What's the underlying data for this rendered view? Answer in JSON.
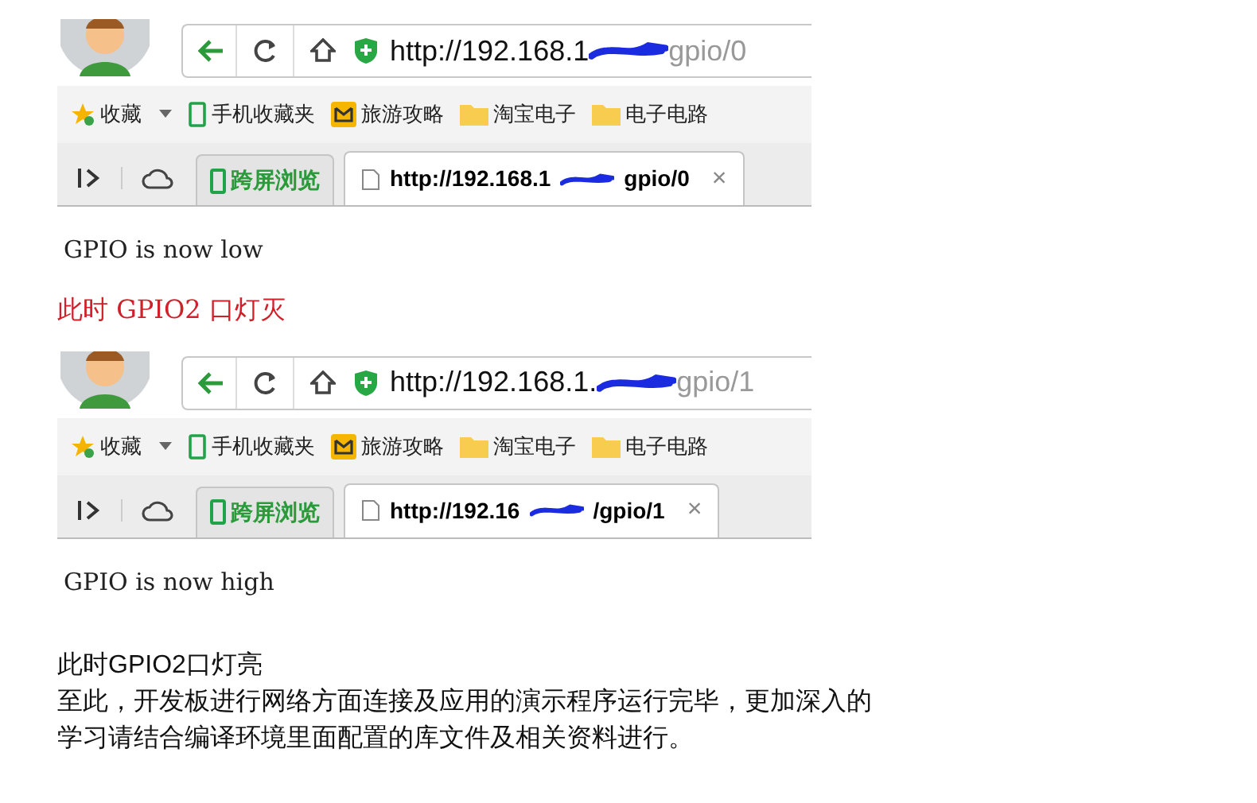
{
  "screenshots": [
    {
      "address": {
        "start": "http://192.168.1",
        "end": "gpio/0"
      },
      "bookmarks": [
        {
          "kind": "star",
          "label": "收藏"
        },
        {
          "kind": "phone",
          "label": "手机收藏夹"
        },
        {
          "kind": "bag",
          "label": "旅游攻略"
        },
        {
          "kind": "folder",
          "label": "淘宝电子"
        },
        {
          "kind": "folder",
          "label": "电子电路"
        }
      ],
      "cross_screen": "跨屏浏览",
      "tab": {
        "start": "http://192.168.1",
        "end": "gpio/0",
        "close": "×"
      },
      "page_text": "GPIO is now low",
      "caption": "此时 GPIO2 口灯灭"
    },
    {
      "address": {
        "start": "http://192.168.1.",
        "end": "gpio/1"
      },
      "bookmarks": [
        {
          "kind": "star",
          "label": "收藏"
        },
        {
          "kind": "phone",
          "label": "手机收藏夹"
        },
        {
          "kind": "bag",
          "label": "旅游攻略"
        },
        {
          "kind": "folder",
          "label": "淘宝电子"
        },
        {
          "kind": "folder",
          "label": "电子电路"
        }
      ],
      "cross_screen": "跨屏浏览",
      "tab": {
        "start": "http://192.16",
        "end": "/gpio/1",
        "close": "×"
      },
      "page_text": "GPIO is now high"
    }
  ],
  "footer": [
    "此时GPIO2口灯亮",
    "至此，开发板进行网络方面连接及应用的演示程序运行完毕，更加深入的",
    "学习请结合编译环境里面配置的库文件及相关资料进行。"
  ]
}
